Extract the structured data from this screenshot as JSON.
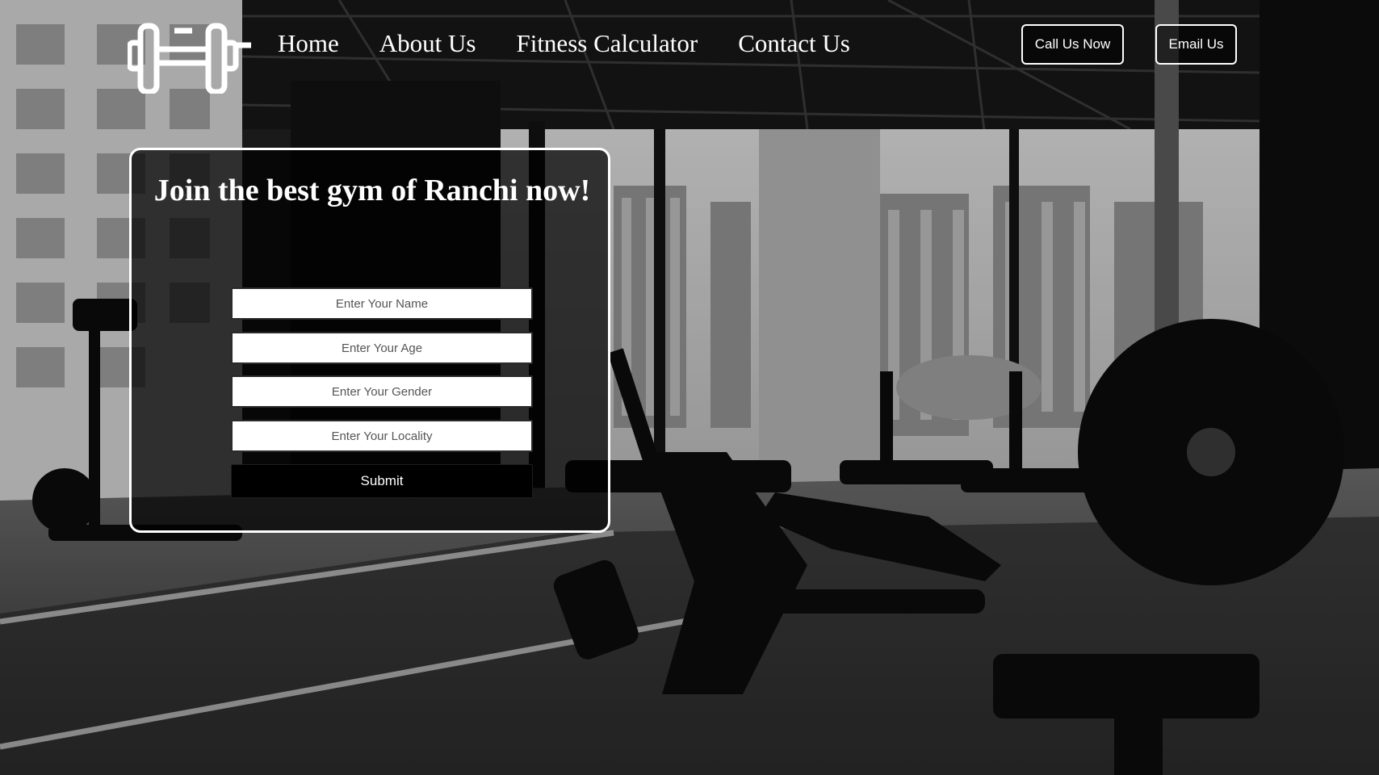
{
  "header": {
    "logo_icon": "dumbbell-icon",
    "nav": [
      {
        "label": "Home"
      },
      {
        "label": "About Us"
      },
      {
        "label": "Fitness Calculator"
      },
      {
        "label": "Contact Us"
      }
    ],
    "call_button": "Call Us Now",
    "email_button": "Email Us"
  },
  "join_form": {
    "title": "Join the best gym of Ranchi now!",
    "fields": {
      "name_placeholder": "Enter Your Name",
      "age_placeholder": "Enter Your Age",
      "gender_placeholder": "Enter Your Gender",
      "locality_placeholder": "Enter Your Locality"
    },
    "submit_label": "Submit"
  },
  "colors": {
    "text": "#ffffff",
    "card_border": "#ffffff",
    "card_background": "#000000",
    "background_tone": "grayscale"
  }
}
